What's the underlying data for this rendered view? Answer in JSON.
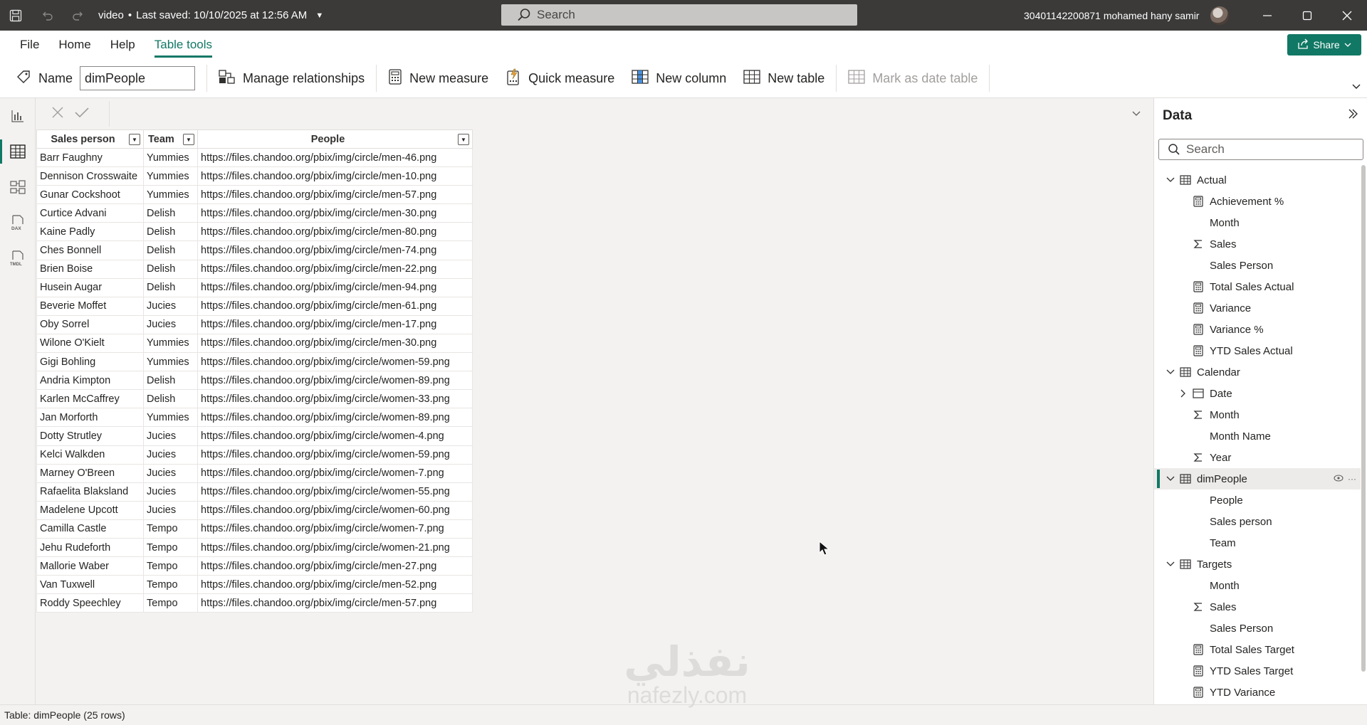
{
  "titlebar": {
    "file_name": "video",
    "saved_status": "Last saved: 10/10/2025 at 12:56 AM",
    "search_placeholder": "Search",
    "user_name": "30401142200871 mohamed hany samir"
  },
  "menu": {
    "tabs": [
      "File",
      "Home",
      "Help",
      "Table tools"
    ],
    "active_tab": "Table tools",
    "share_label": "Share"
  },
  "ribbon": {
    "name_label": "Name",
    "name_value": "dimPeople",
    "manage_relationships": "Manage relationships",
    "new_measure": "New measure",
    "quick_measure": "Quick measure",
    "new_column": "New column",
    "new_table": "New table",
    "mark_as_date_table": "Mark as date table"
  },
  "table": {
    "columns": [
      "Sales person",
      "Team",
      "People"
    ],
    "rows": [
      [
        "Barr Faughny",
        "Yummies",
        "https://files.chandoo.org/pbix/img/circle/men-46.png"
      ],
      [
        "Dennison Crosswaite",
        "Yummies",
        "https://files.chandoo.org/pbix/img/circle/men-10.png"
      ],
      [
        "Gunar Cockshoot",
        "Yummies",
        "https://files.chandoo.org/pbix/img/circle/men-57.png"
      ],
      [
        "Curtice Advani",
        "Delish",
        "https://files.chandoo.org/pbix/img/circle/men-30.png"
      ],
      [
        "Kaine Padly",
        "Delish",
        "https://files.chandoo.org/pbix/img/circle/men-80.png"
      ],
      [
        "Ches Bonnell",
        "Delish",
        "https://files.chandoo.org/pbix/img/circle/men-74.png"
      ],
      [
        "Brien Boise",
        "Delish",
        "https://files.chandoo.org/pbix/img/circle/men-22.png"
      ],
      [
        "Husein Augar",
        "Delish",
        "https://files.chandoo.org/pbix/img/circle/men-94.png"
      ],
      [
        "Beverie Moffet",
        "Jucies",
        "https://files.chandoo.org/pbix/img/circle/men-61.png"
      ],
      [
        "Oby Sorrel",
        "Jucies",
        "https://files.chandoo.org/pbix/img/circle/men-17.png"
      ],
      [
        "Wilone O'Kielt",
        "Yummies",
        "https://files.chandoo.org/pbix/img/circle/men-30.png"
      ],
      [
        "Gigi Bohling",
        "Yummies",
        "https://files.chandoo.org/pbix/img/circle/women-59.png"
      ],
      [
        "Andria Kimpton",
        "Delish",
        "https://files.chandoo.org/pbix/img/circle/women-89.png"
      ],
      [
        "Karlen McCaffrey",
        "Delish",
        "https://files.chandoo.org/pbix/img/circle/women-33.png"
      ],
      [
        "Jan Morforth",
        "Yummies",
        "https://files.chandoo.org/pbix/img/circle/women-89.png"
      ],
      [
        "Dotty Strutley",
        "Jucies",
        "https://files.chandoo.org/pbix/img/circle/women-4.png"
      ],
      [
        "Kelci Walkden",
        "Jucies",
        "https://files.chandoo.org/pbix/img/circle/women-59.png"
      ],
      [
        "Marney O'Breen",
        "Jucies",
        "https://files.chandoo.org/pbix/img/circle/women-7.png"
      ],
      [
        "Rafaelita Blaksland",
        "Jucies",
        "https://files.chandoo.org/pbix/img/circle/women-55.png"
      ],
      [
        "Madelene Upcott",
        "Jucies",
        "https://files.chandoo.org/pbix/img/circle/women-60.png"
      ],
      [
        "Camilla Castle",
        "Tempo",
        "https://files.chandoo.org/pbix/img/circle/women-7.png"
      ],
      [
        "Jehu Rudeforth",
        "Tempo",
        "https://files.chandoo.org/pbix/img/circle/women-21.png"
      ],
      [
        "Mallorie Waber",
        "Tempo",
        "https://files.chandoo.org/pbix/img/circle/men-27.png"
      ],
      [
        "Van Tuxwell",
        "Tempo",
        "https://files.chandoo.org/pbix/img/circle/men-52.png"
      ],
      [
        "Roddy Speechley",
        "Tempo",
        "https://files.chandoo.org/pbix/img/circle/men-57.png"
      ]
    ]
  },
  "data_pane": {
    "title": "Data",
    "search_placeholder": "Search",
    "tree": [
      {
        "label": "Actual",
        "level": 0,
        "icon": "table-icon",
        "expanded": true
      },
      {
        "label": "Achievement %",
        "level": 1,
        "icon": "calculator-icon"
      },
      {
        "label": "Month",
        "level": 1,
        "icon": "none"
      },
      {
        "label": "Sales",
        "level": 1,
        "icon": "sigma-icon"
      },
      {
        "label": "Sales Person",
        "level": 1,
        "icon": "none"
      },
      {
        "label": "Total Sales Actual",
        "level": 1,
        "icon": "calculator-icon"
      },
      {
        "label": "Variance",
        "level": 1,
        "icon": "calculator-icon"
      },
      {
        "label": "Variance %",
        "level": 1,
        "icon": "calculator-icon"
      },
      {
        "label": "YTD Sales Actual",
        "level": 1,
        "icon": "calculator-icon"
      },
      {
        "label": "Calendar",
        "level": 0,
        "icon": "table-icon",
        "expanded": true
      },
      {
        "label": "Date",
        "level": 1,
        "icon": "calendar-icon",
        "collapsed_child": true
      },
      {
        "label": "Month",
        "level": 1,
        "icon": "sigma-icon"
      },
      {
        "label": "Month Name",
        "level": 1,
        "icon": "none"
      },
      {
        "label": "Year",
        "level": 1,
        "icon": "sigma-icon"
      },
      {
        "label": "dimPeople",
        "level": 0,
        "icon": "table-icon",
        "expanded": true,
        "selected": true
      },
      {
        "label": "People",
        "level": 1,
        "icon": "none"
      },
      {
        "label": "Sales person",
        "level": 1,
        "icon": "none"
      },
      {
        "label": "Team",
        "level": 1,
        "icon": "none"
      },
      {
        "label": "Targets",
        "level": 0,
        "icon": "table-icon",
        "expanded": true
      },
      {
        "label": "Month",
        "level": 1,
        "icon": "none"
      },
      {
        "label": "Sales",
        "level": 1,
        "icon": "sigma-icon"
      },
      {
        "label": "Sales Person",
        "level": 1,
        "icon": "none"
      },
      {
        "label": "Total Sales Target",
        "level": 1,
        "icon": "calculator-icon"
      },
      {
        "label": "YTD Sales Target",
        "level": 1,
        "icon": "calculator-icon"
      },
      {
        "label": "YTD Variance",
        "level": 1,
        "icon": "calculator-icon"
      }
    ]
  },
  "statusbar": {
    "text": "Table: dimPeople (25 rows)"
  },
  "watermark": {
    "arabic": "نفذلي",
    "latin": "nafezly.com"
  },
  "colors": {
    "accent": "#117865",
    "titlebar": "#3b3a39"
  }
}
